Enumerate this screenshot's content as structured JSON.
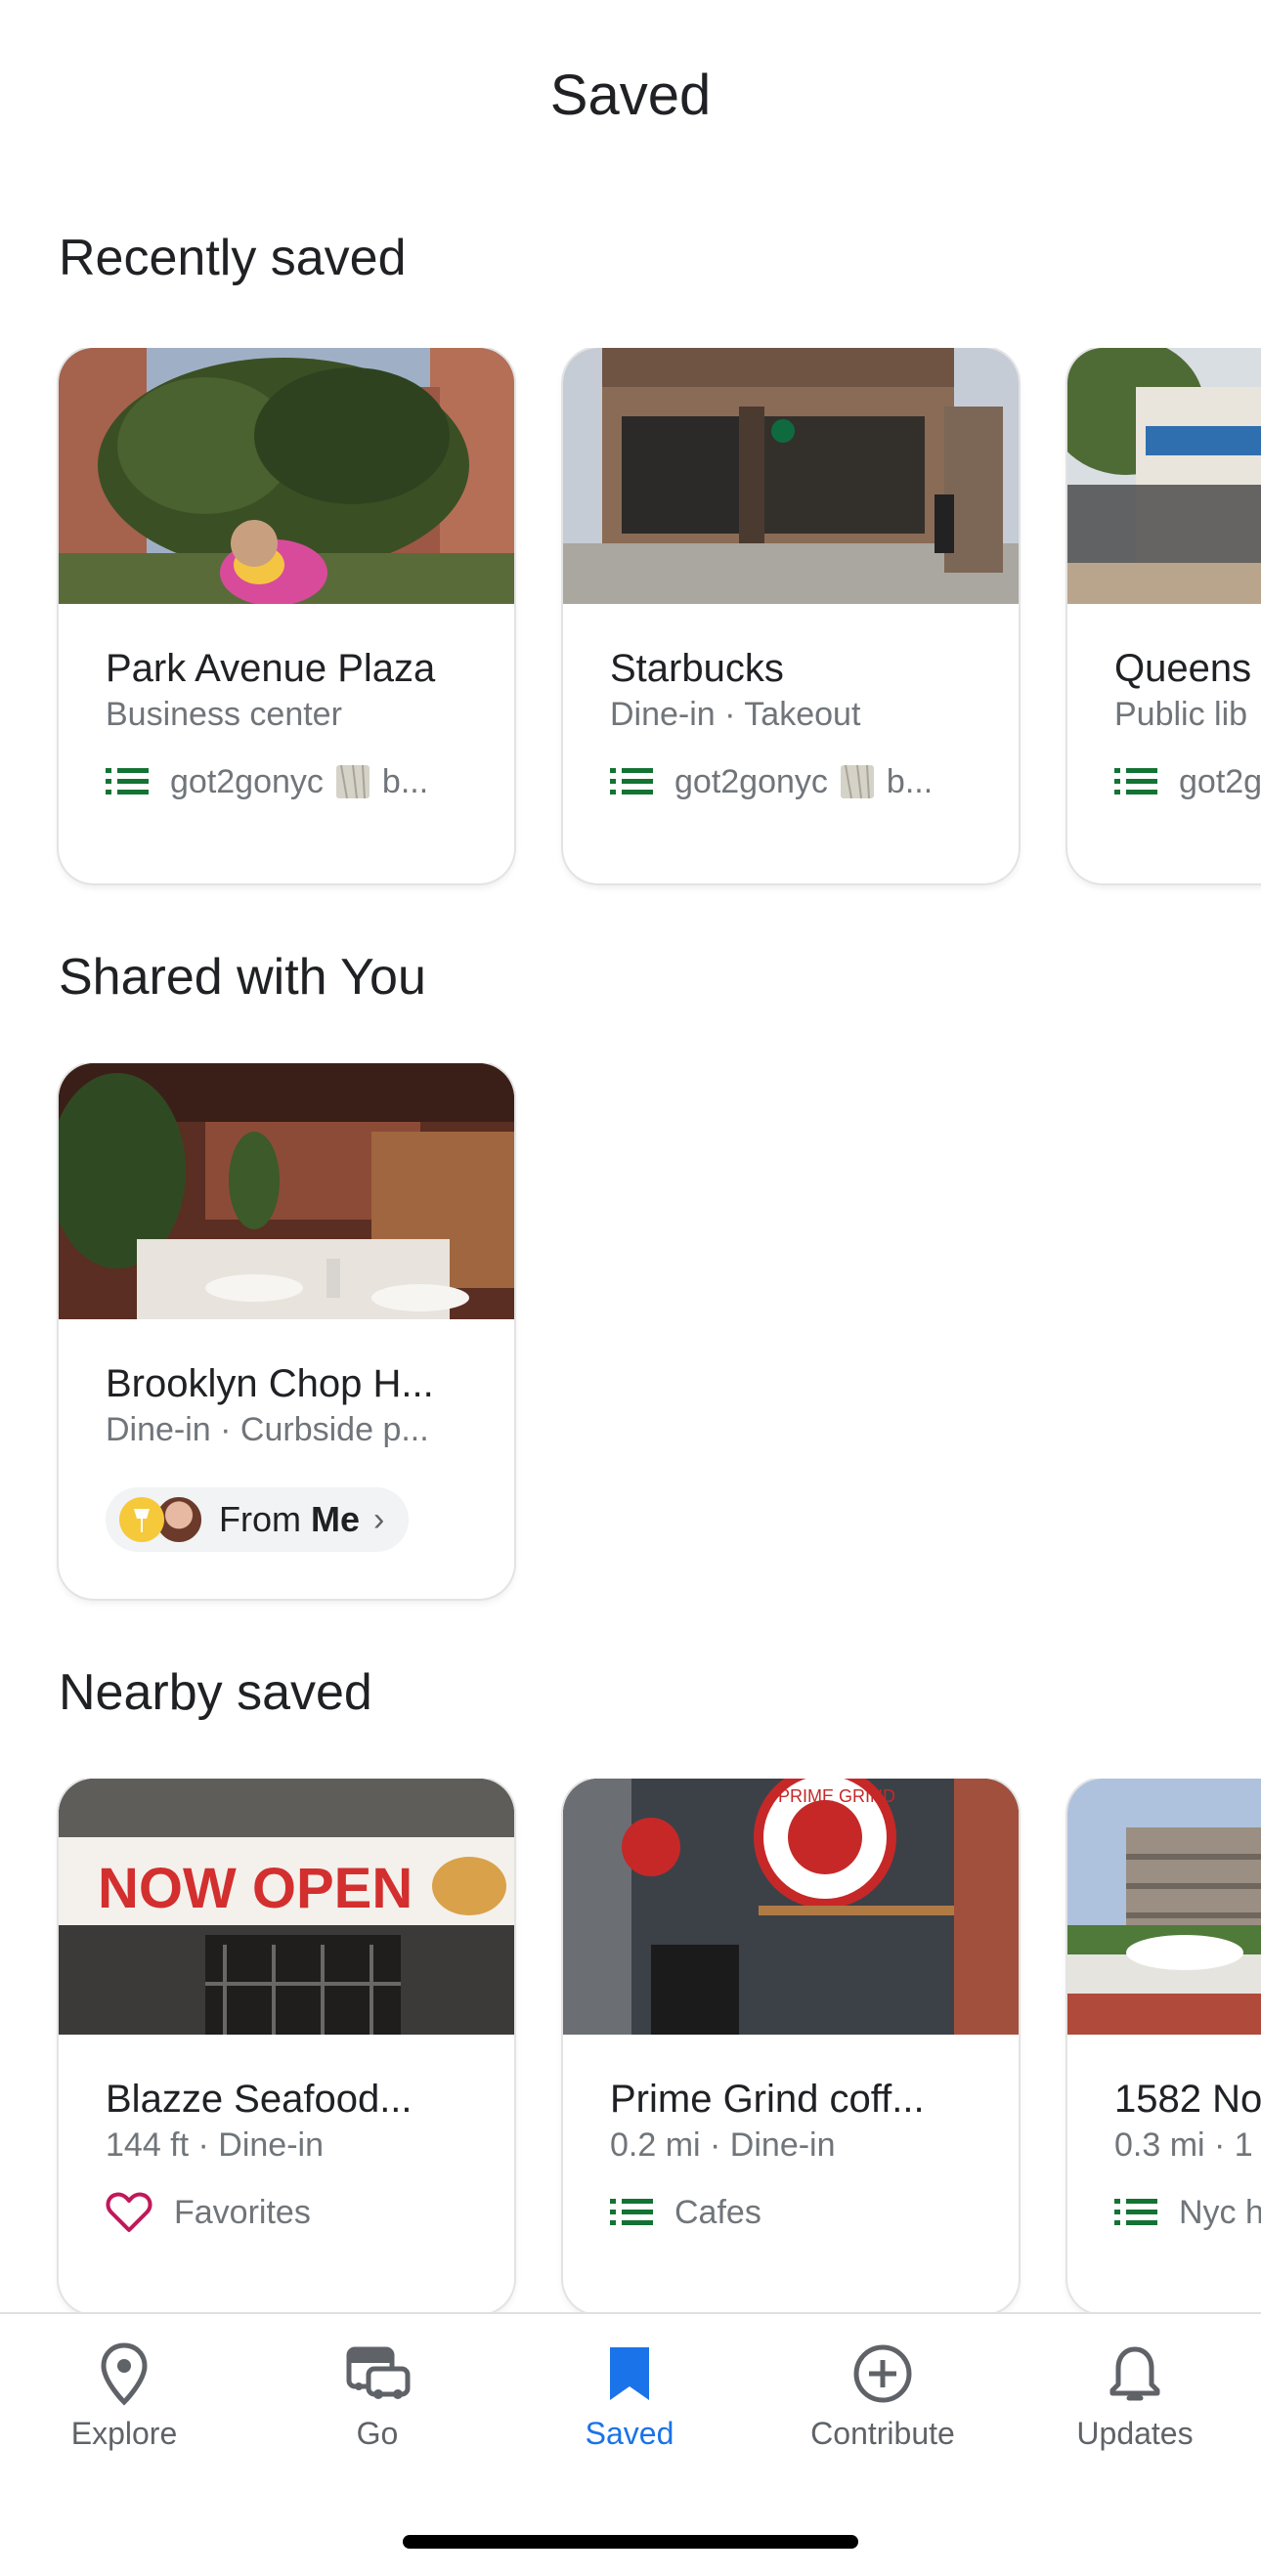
{
  "header": {
    "title": "Saved"
  },
  "sections": {
    "recent": {
      "title": "Recently saved",
      "cards": [
        {
          "title": "Park Avenue Plaza",
          "subtitle": "Business center",
          "list": "got2gonyc",
          "extra": "b..."
        },
        {
          "title": "Starbucks",
          "subtitle": "Dine-in · Takeout",
          "list": "got2gonyc",
          "extra": "b..."
        },
        {
          "title": "Queens",
          "subtitle": "Public lib",
          "list": "got2g"
        }
      ]
    },
    "shared": {
      "title": "Shared with You",
      "cards": [
        {
          "title": "Brooklyn Chop H...",
          "subtitle": "Dine-in · Curbside p...",
          "from_prefix": "From",
          "from_name": "Me"
        }
      ]
    },
    "nearby": {
      "title": "Nearby saved",
      "cards": [
        {
          "title": "Blazze Seafood...",
          "subtitle": "144 ft · Dine-in",
          "list": "Favorites",
          "banner": "NOW OPEN"
        },
        {
          "title": "Prime Grind coff...",
          "subtitle": "0.2 mi · Dine-in",
          "list": "Cafes",
          "sign": "PRIME GRIND"
        },
        {
          "title": "1582 No",
          "subtitle": "0.3 mi · 1",
          "list": "Nyc h"
        }
      ]
    }
  },
  "nav": {
    "items": [
      {
        "label": "Explore",
        "icon": "map-pin-icon"
      },
      {
        "label": "Go",
        "icon": "car-icon"
      },
      {
        "label": "Saved",
        "icon": "bookmark-icon",
        "active": true
      },
      {
        "label": "Contribute",
        "icon": "add-circle-icon"
      },
      {
        "label": "Updates",
        "icon": "bell-icon"
      }
    ]
  },
  "colors": {
    "accent": "#1a73e8",
    "list_icon": "#137333",
    "heart": "#c2185b",
    "text_secondary": "#70757a"
  }
}
